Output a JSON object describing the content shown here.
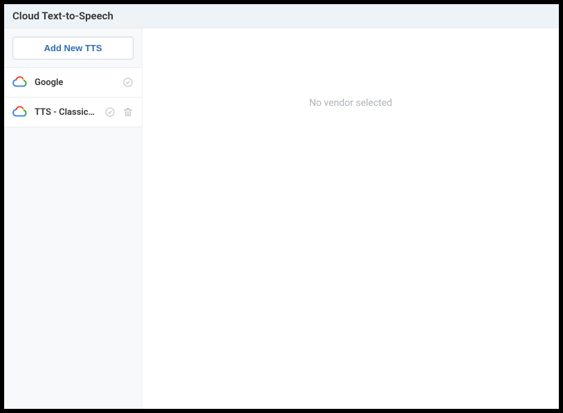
{
  "header": {
    "title": "Cloud Text-to-Speech"
  },
  "sidebar": {
    "add_label": "Add New TTS",
    "items": [
      {
        "label": "Google",
        "show_trash": false
      },
      {
        "label": "TTS - Classics ...",
        "show_trash": true
      }
    ]
  },
  "main": {
    "empty_label": "No vendor selected"
  }
}
